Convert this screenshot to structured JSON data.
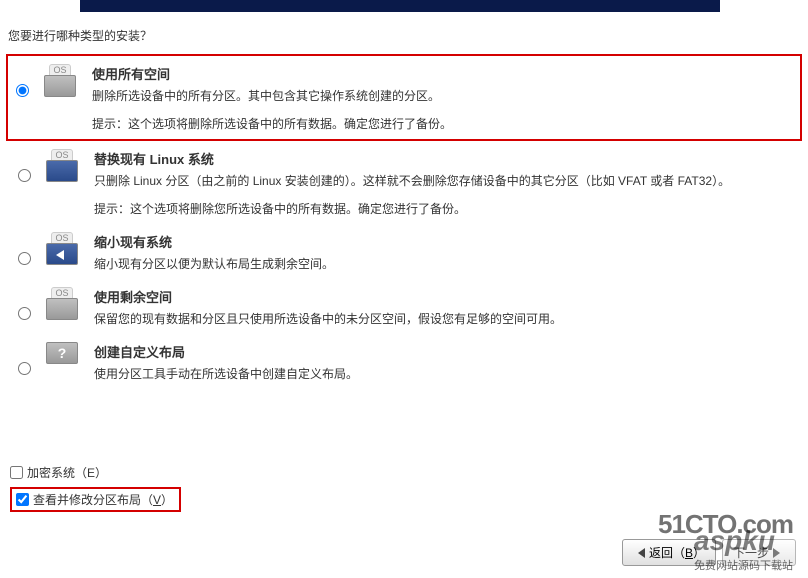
{
  "question": "您要进行哪种类型的安装？",
  "options": [
    {
      "title": "使用所有空间",
      "desc": "删除所选设备中的所有分区。其中包含其它操作系统创建的分区。",
      "hint": "提示：这个选项将删除所选设备中的所有数据。确定您进行了备份。",
      "icon_os": "OS"
    },
    {
      "title": "替换现有 Linux 系统",
      "desc": "只删除 Linux 分区（由之前的 Linux 安装创建的）。这样就不会删除您存储设备中的其它分区（比如 VFAT 或者 FAT32）。",
      "hint": "提示：这个选项将删除您所选设备中的所有数据。确定您进行了备份。",
      "icon_os": "OS"
    },
    {
      "title": "缩小现有系统",
      "desc": "缩小现有分区以便为默认布局生成剩余空间。",
      "hint": "",
      "icon_os": "OS"
    },
    {
      "title": "使用剩余空间",
      "desc": "保留您的现有数据和分区且只使用所选设备中的未分区空间，假设您有足够的空间可用。",
      "hint": "",
      "icon_os": "OS"
    },
    {
      "title": "创建自定义布局",
      "desc": "使用分区工具手动在所选设备中创建自定义布局。",
      "hint": "",
      "icon_os": ""
    }
  ],
  "checkboxes": {
    "encrypt": "加密系统（E）",
    "review": "查看并修改分区布局（V）",
    "review_key": "V"
  },
  "nav": {
    "back": "返回（B）",
    "next": "下一步"
  },
  "watermark": {
    "w1": "51CTO.com",
    "w2": "aspku",
    "w2sub": "免费网站源码下载站"
  }
}
